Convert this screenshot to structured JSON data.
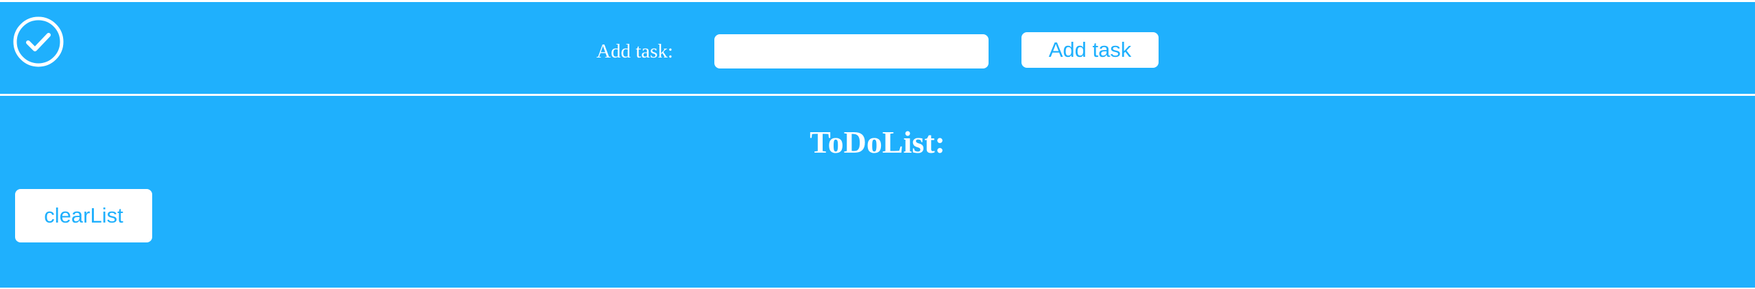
{
  "header": {
    "logo_icon": "check-circle-icon",
    "add_label": "Add task:",
    "task_input": {
      "value": "",
      "placeholder": ""
    },
    "add_button_label": "Add task"
  },
  "main": {
    "title": "ToDoList:",
    "clear_button_label": "clearList",
    "tasks": []
  },
  "colors": {
    "background": "#1fb0fd",
    "foreground": "#ffffff",
    "button_text": "#1fb0fd"
  }
}
